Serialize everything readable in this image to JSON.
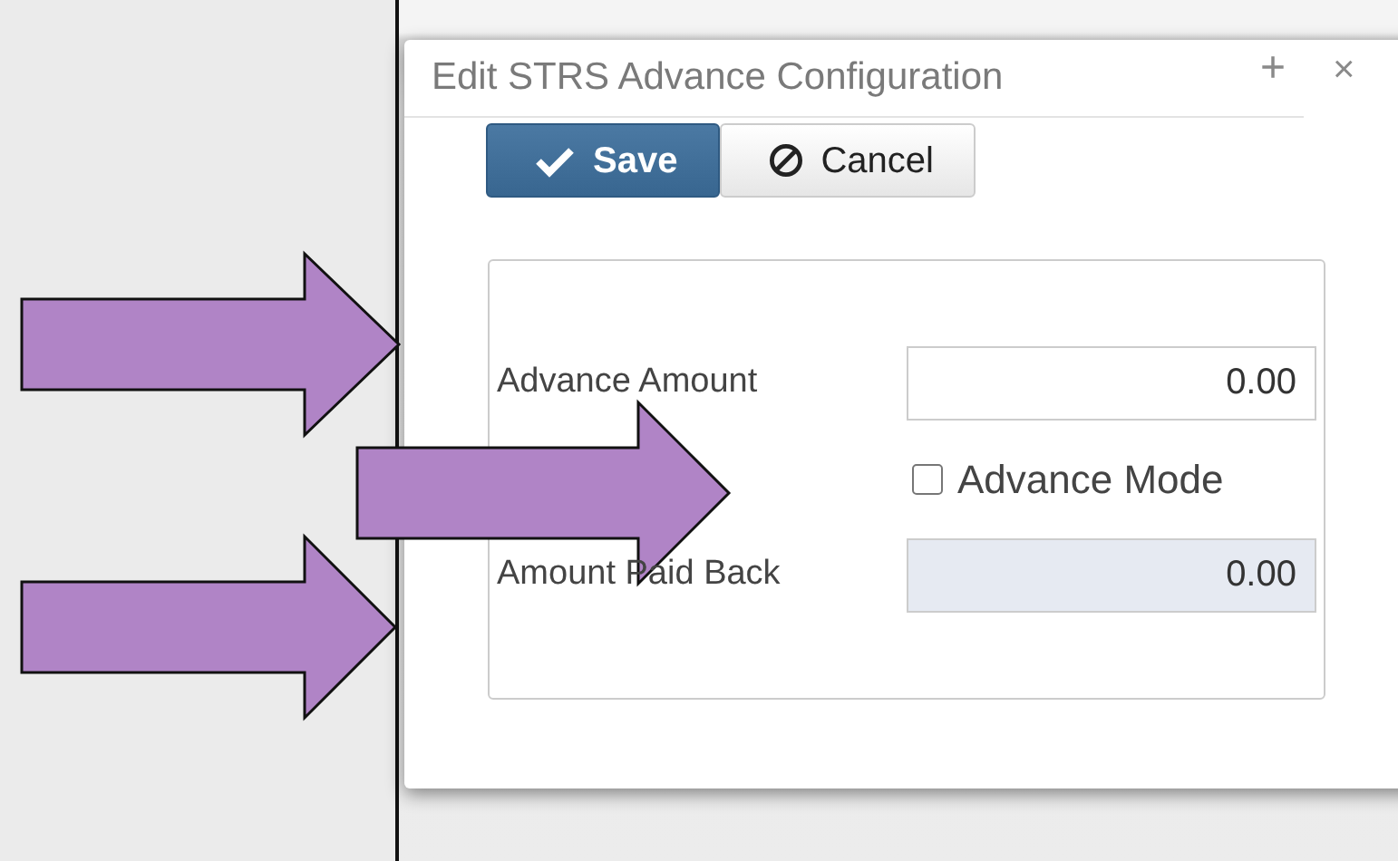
{
  "dialog": {
    "title": "Edit STRS Advance Configuration",
    "title_buttons": [
      {
        "kind": "add",
        "label": "+"
      },
      {
        "kind": "close",
        "label": "×"
      }
    ]
  },
  "buttons": [
    {
      "kind": "primary",
      "label": "Save"
    },
    {
      "kind": "default",
      "label": "Cancel"
    }
  ],
  "fields": [
    {
      "kind": "input",
      "label": "Advance Amount",
      "value": "0.00",
      "readonly": false
    },
    {
      "kind": "checkbox",
      "label": "Advance Mode",
      "checked": false
    },
    {
      "kind": "input",
      "label": "Amount Paid Back",
      "value": "0.00",
      "readonly": true
    }
  ]
}
